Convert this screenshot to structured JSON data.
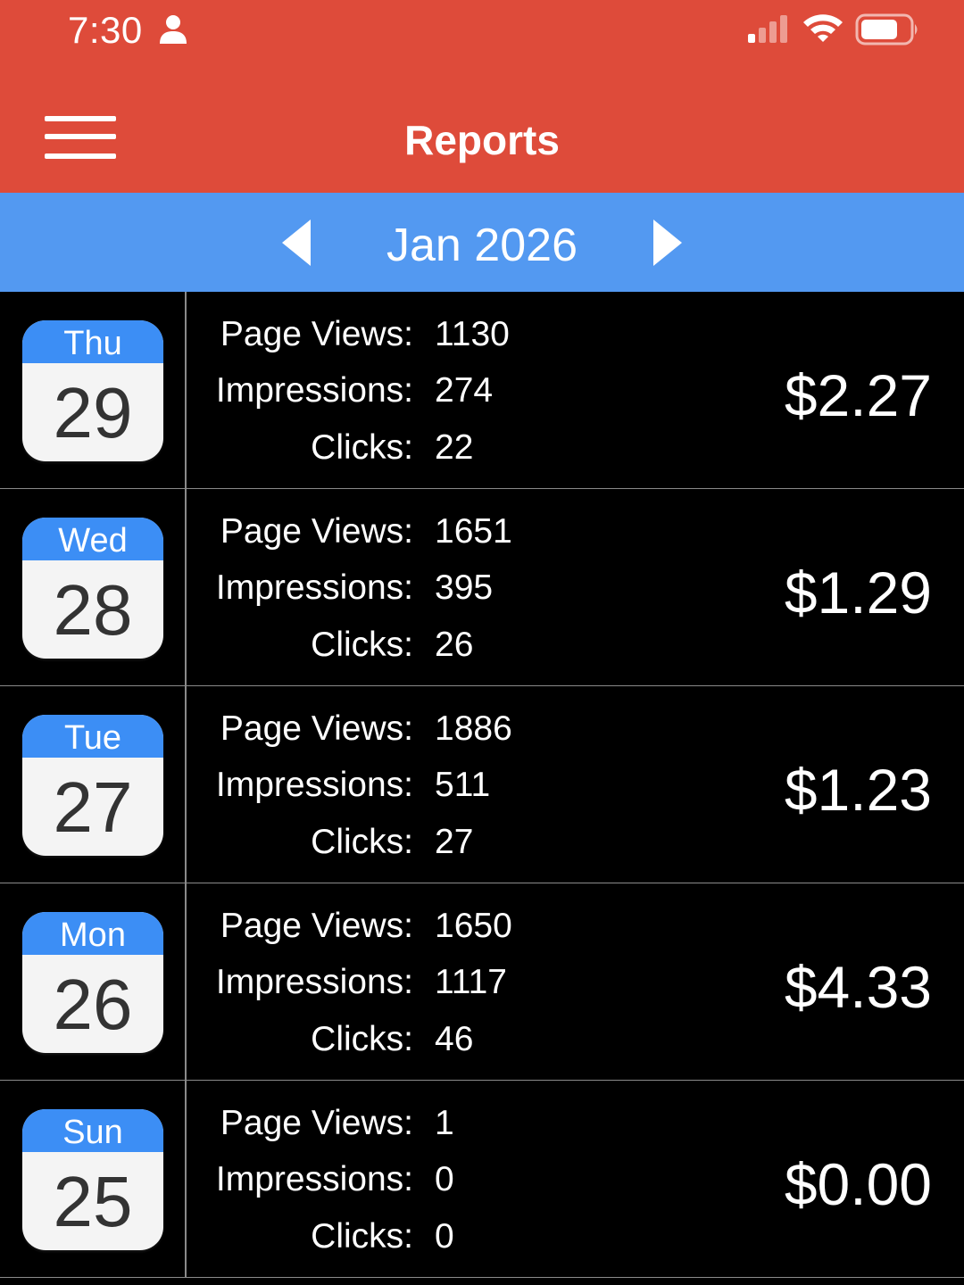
{
  "status_bar": {
    "time": "7:30"
  },
  "header": {
    "title": "Reports",
    "accent_color": "#DE4B3A"
  },
  "month_nav": {
    "label": "Jan 2026",
    "bar_color": "#5399F1"
  },
  "labels": {
    "page_views": "Page Views:",
    "impressions": "Impressions:",
    "clicks": "Clicks:"
  },
  "rows": [
    {
      "dow": "Thu",
      "day": "29",
      "page_views": "1130",
      "impressions": "274",
      "clicks": "22",
      "earnings": "$2.27"
    },
    {
      "dow": "Wed",
      "day": "28",
      "page_views": "1651",
      "impressions": "395",
      "clicks": "26",
      "earnings": "$1.29"
    },
    {
      "dow": "Tue",
      "day": "27",
      "page_views": "1886",
      "impressions": "511",
      "clicks": "27",
      "earnings": "$1.23"
    },
    {
      "dow": "Mon",
      "day": "26",
      "page_views": "1650",
      "impressions": "1117",
      "clicks": "46",
      "earnings": "$4.33"
    },
    {
      "dow": "Sun",
      "day": "25",
      "page_views": "1",
      "impressions": "0",
      "clicks": "0",
      "earnings": "$0.00"
    }
  ],
  "icons": {
    "status": [
      "person-icon",
      "signal-icon",
      "wifi-icon",
      "battery-icon"
    ],
    "nav": [
      "menu-icon",
      "chevron-left-icon",
      "chevron-right-icon"
    ],
    "row": "calendar-icon"
  }
}
